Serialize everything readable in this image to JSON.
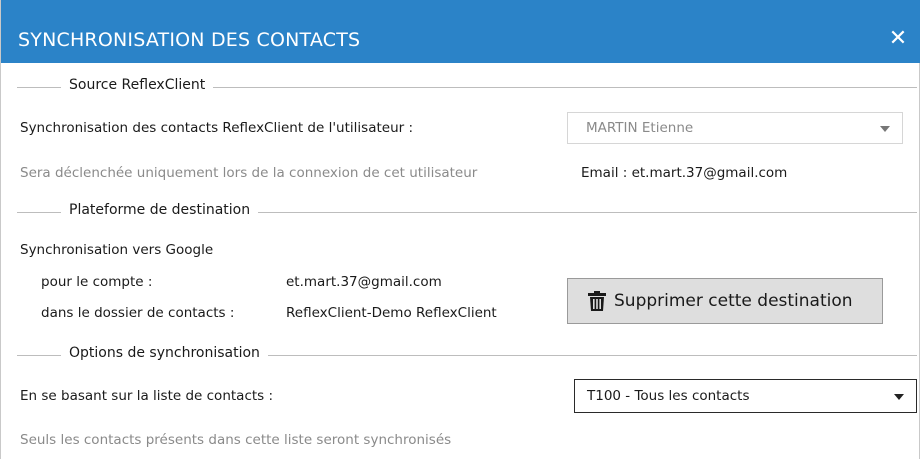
{
  "window": {
    "title": "SYNCHRONISATION DES CONTACTS",
    "close_glyph": "✕"
  },
  "source": {
    "section_label": "Source ReflexClient",
    "sync_user_label": "Synchronisation des contacts ReflexClient de l'utilisateur :",
    "user_select_value": "MARTIN Etienne",
    "hint": "Sera déclenchée uniquement lors de la connexion de cet utilisateur",
    "email_text": "Email : et.mart.37@gmail.com"
  },
  "destination": {
    "section_label": "Plateforme de destination",
    "sync_to": "Synchronisation vers Google",
    "account_label": "pour le compte :",
    "account_value": "et.mart.37@gmail.com",
    "folder_label": "dans le dossier de contacts :",
    "folder_value": "ReflexClient-Demo ReflexClient",
    "delete_button_label": "Supprimer cette destination",
    "delete_icon": "trash-icon"
  },
  "options": {
    "section_label": "Options de synchronisation",
    "list_label": "En se basant sur la liste de contacts :",
    "list_select_value": "T100 - Tous les contacts",
    "hint": "Seuls les contacts présents dans cette liste seront synchronisés"
  },
  "colors": {
    "titlebar": "#2b83c8",
    "button_bg": "#dedede"
  }
}
